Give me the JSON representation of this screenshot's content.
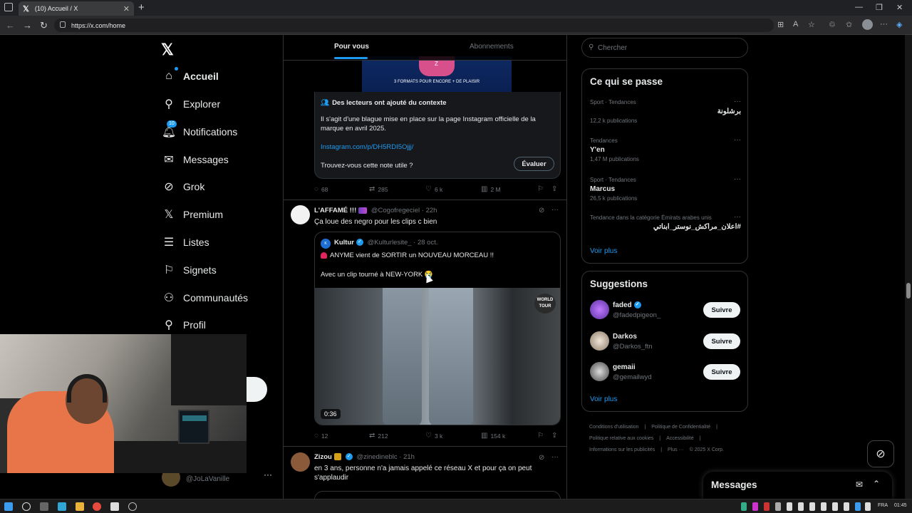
{
  "browser": {
    "tab_title": "(10) Accueil / X",
    "url": "https://x.com/home",
    "new_tab_label": "+"
  },
  "nav": {
    "items": [
      {
        "label": "Accueil",
        "icon": "home-icon"
      },
      {
        "label": "Explorer",
        "icon": "search-icon"
      },
      {
        "label": "Notifications",
        "icon": "bell-icon",
        "badge": "10"
      },
      {
        "label": "Messages",
        "icon": "envelope-icon"
      },
      {
        "label": "Grok",
        "icon": "grok-icon"
      },
      {
        "label": "Premium",
        "icon": "x-icon"
      },
      {
        "label": "Listes",
        "icon": "list-icon"
      },
      {
        "label": "Signets",
        "icon": "bookmark-icon"
      },
      {
        "label": "Communautés",
        "icon": "people-icon"
      },
      {
        "label": "Profil",
        "icon": "person-icon"
      }
    ],
    "user_handle": "@JoLaVanille"
  },
  "timeline": {
    "tabs": [
      "Pour vous",
      "Abonnements"
    ],
    "promo_text": "3 FORMATS POUR ENCORE + DE PLAISIR",
    "promo_letter": "Z",
    "note": {
      "title": "Des lecteurs ont ajouté du contexte",
      "body": "Il s'agit d'une blague mise en place sur la page Instagram officielle de la marque en avril 2025.",
      "link": "Instagram.com/p/DH5RDI5Ojjj/",
      "question": "Trouvez-vous cette note utile ?",
      "button": "Évaluer"
    },
    "tweet0_actions": {
      "replies": "68",
      "reposts": "285",
      "likes": "6 k",
      "views": "2 M"
    },
    "tweet1": {
      "name": "L'AFFAMÉ !!!",
      "handle": "@Cogofregeciel",
      "time": "· 22h",
      "text": "Ça loue des negro pour les clips c bien",
      "quote": {
        "name": "Kultur",
        "handle": "@Kulturlesite_",
        "time": "· 28 oct.",
        "line1": "ANYME vient de SORTIR un NOUVEAU MORCEAU !!",
        "line2": "Avec un clip tourné à NEW-YORK 😭",
        "duration": "0:36",
        "video_badge": "WORLD TOUR"
      },
      "actions": {
        "replies": "12",
        "reposts": "212",
        "likes": "3 k",
        "views": "154 k"
      }
    },
    "tweet2": {
      "name": "Zizou",
      "handle": "@zinedineblc",
      "time": "· 21h",
      "text": "en 3 ans, personne n'a jamais appelé ce réseau X et pour ça on peut s'applaudir"
    }
  },
  "right": {
    "search_placeholder": "Chercher",
    "trends_title": "Ce qui se passe",
    "trends": [
      {
        "category": "Sport · Tendances",
        "name": "برشلونة",
        "count": "12,2 k publications",
        "rtl": true
      },
      {
        "category": "Tendances",
        "name": "Y'en",
        "count": "1,47 M publications",
        "rtl": false
      },
      {
        "category": "Sport · Tendances",
        "name": "Marcus",
        "count": "26,5 k publications",
        "rtl": false
      },
      {
        "category": "Tendance dans la catégorie Émirats arabes unis",
        "name": "#اعلان_مراكش_نوستر_ابناتي",
        "count": "",
        "rtl": true
      }
    ],
    "show_more": "Voir plus",
    "suggestions_title": "Suggestions",
    "suggestions": [
      {
        "name": "faded",
        "handle": "@fadedpigeon_",
        "verified": true,
        "button": "Suivre"
      },
      {
        "name": "Darkos",
        "handle": "@Darkos_ftn",
        "verified": false,
        "button": "Suivre"
      },
      {
        "name": "gemaii",
        "handle": "@gemailwyd",
        "verified": false,
        "button": "Suivre"
      }
    ],
    "footer": [
      "Conditions d'utilisation",
      "|",
      "Politique de Confidentialité",
      "|",
      "Politique relative aux cookies",
      "|",
      "Accessibilité",
      "|",
      "Informations sur les publicités",
      "|",
      "Plus ···",
      "© 2025 X Corp."
    ]
  },
  "messages_drawer": {
    "title": "Messages"
  },
  "taskbar": {
    "lang": "FRA",
    "time": "01:45"
  },
  "colors": {
    "accent": "#1d9bf0",
    "background": "#000000",
    "border": "#2f3336",
    "muted": "#71767b"
  }
}
